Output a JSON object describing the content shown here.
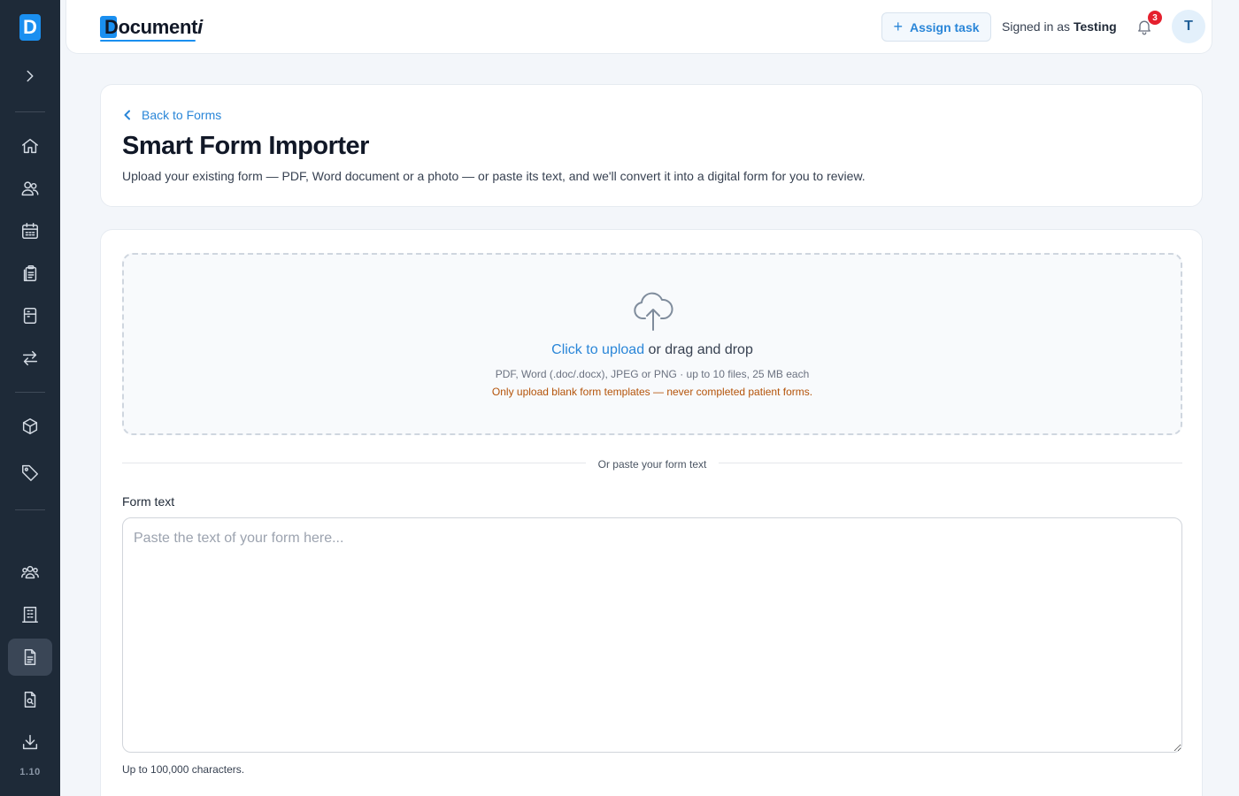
{
  "sidebar": {
    "logo_letter": "D",
    "version": "1.10",
    "items": [
      {
        "name": "expand-icon"
      },
      {
        "name": "home-icon"
      },
      {
        "name": "users-icon"
      },
      {
        "name": "calendar-icon"
      },
      {
        "name": "clipboard-icon"
      },
      {
        "name": "cabinet-icon"
      },
      {
        "name": "transfer-icon"
      },
      {
        "name": "box-icon"
      },
      {
        "name": "tag-icon"
      },
      {
        "name": "team-icon"
      },
      {
        "name": "building-icon"
      },
      {
        "name": "form-document-icon"
      },
      {
        "name": "document-search-icon"
      },
      {
        "name": "download-icon"
      }
    ],
    "active_item": "form-document-icon"
  },
  "header": {
    "brand_main": "Document",
    "brand_italic": "i",
    "assign_task_label": "Assign task",
    "signed_in_prefix": "Signed in as",
    "signed_in_user": "Testing",
    "notification_count": "3",
    "avatar_initial": "T"
  },
  "page": {
    "back_link": "Back to Forms",
    "title": "Smart Form Importer",
    "subtitle": "Upload your existing form — PDF, Word document or a photo — or paste its text, and we'll convert it into a digital form for you to review."
  },
  "upload": {
    "click_label": "Click to upload",
    "drag_label": "or drag and drop",
    "formats": "PDF, Word (.doc/.docx), JPEG or PNG · up to 10 files, 25 MB each",
    "warning": "Only upload blank form templates — never completed patient forms."
  },
  "paste": {
    "separator": "Or paste your form text",
    "field_label": "Form text",
    "placeholder": "Paste the text of your form here...",
    "value": "",
    "hint": "Up to 100,000 characters."
  },
  "colors": {
    "accent": "#2a86d8",
    "sidebar_bg": "#1e2a38",
    "warning": "#b45309",
    "badge": "#e5202e"
  }
}
